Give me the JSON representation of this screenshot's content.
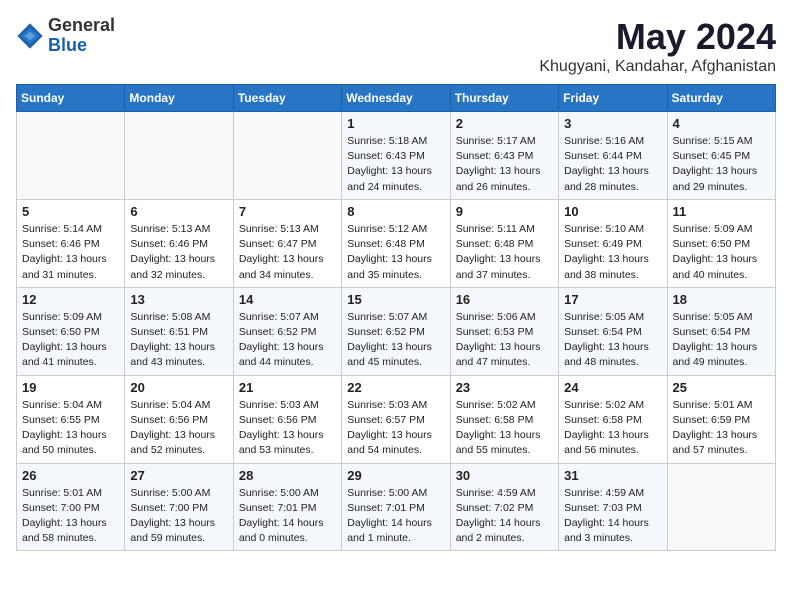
{
  "header": {
    "logo_general": "General",
    "logo_blue": "Blue",
    "month_title": "May 2024",
    "location": "Khugyani, Kandahar, Afghanistan"
  },
  "weekdays": [
    "Sunday",
    "Monday",
    "Tuesday",
    "Wednesday",
    "Thursday",
    "Friday",
    "Saturday"
  ],
  "weeks": [
    [
      {
        "day": "",
        "info": ""
      },
      {
        "day": "",
        "info": ""
      },
      {
        "day": "",
        "info": ""
      },
      {
        "day": "1",
        "info": "Sunrise: 5:18 AM\nSunset: 6:43 PM\nDaylight: 13 hours\nand 24 minutes."
      },
      {
        "day": "2",
        "info": "Sunrise: 5:17 AM\nSunset: 6:43 PM\nDaylight: 13 hours\nand 26 minutes."
      },
      {
        "day": "3",
        "info": "Sunrise: 5:16 AM\nSunset: 6:44 PM\nDaylight: 13 hours\nand 28 minutes."
      },
      {
        "day": "4",
        "info": "Sunrise: 5:15 AM\nSunset: 6:45 PM\nDaylight: 13 hours\nand 29 minutes."
      }
    ],
    [
      {
        "day": "5",
        "info": "Sunrise: 5:14 AM\nSunset: 6:46 PM\nDaylight: 13 hours\nand 31 minutes."
      },
      {
        "day": "6",
        "info": "Sunrise: 5:13 AM\nSunset: 6:46 PM\nDaylight: 13 hours\nand 32 minutes."
      },
      {
        "day": "7",
        "info": "Sunrise: 5:13 AM\nSunset: 6:47 PM\nDaylight: 13 hours\nand 34 minutes."
      },
      {
        "day": "8",
        "info": "Sunrise: 5:12 AM\nSunset: 6:48 PM\nDaylight: 13 hours\nand 35 minutes."
      },
      {
        "day": "9",
        "info": "Sunrise: 5:11 AM\nSunset: 6:48 PM\nDaylight: 13 hours\nand 37 minutes."
      },
      {
        "day": "10",
        "info": "Sunrise: 5:10 AM\nSunset: 6:49 PM\nDaylight: 13 hours\nand 38 minutes."
      },
      {
        "day": "11",
        "info": "Sunrise: 5:09 AM\nSunset: 6:50 PM\nDaylight: 13 hours\nand 40 minutes."
      }
    ],
    [
      {
        "day": "12",
        "info": "Sunrise: 5:09 AM\nSunset: 6:50 PM\nDaylight: 13 hours\nand 41 minutes."
      },
      {
        "day": "13",
        "info": "Sunrise: 5:08 AM\nSunset: 6:51 PM\nDaylight: 13 hours\nand 43 minutes."
      },
      {
        "day": "14",
        "info": "Sunrise: 5:07 AM\nSunset: 6:52 PM\nDaylight: 13 hours\nand 44 minutes."
      },
      {
        "day": "15",
        "info": "Sunrise: 5:07 AM\nSunset: 6:52 PM\nDaylight: 13 hours\nand 45 minutes."
      },
      {
        "day": "16",
        "info": "Sunrise: 5:06 AM\nSunset: 6:53 PM\nDaylight: 13 hours\nand 47 minutes."
      },
      {
        "day": "17",
        "info": "Sunrise: 5:05 AM\nSunset: 6:54 PM\nDaylight: 13 hours\nand 48 minutes."
      },
      {
        "day": "18",
        "info": "Sunrise: 5:05 AM\nSunset: 6:54 PM\nDaylight: 13 hours\nand 49 minutes."
      }
    ],
    [
      {
        "day": "19",
        "info": "Sunrise: 5:04 AM\nSunset: 6:55 PM\nDaylight: 13 hours\nand 50 minutes."
      },
      {
        "day": "20",
        "info": "Sunrise: 5:04 AM\nSunset: 6:56 PM\nDaylight: 13 hours\nand 52 minutes."
      },
      {
        "day": "21",
        "info": "Sunrise: 5:03 AM\nSunset: 6:56 PM\nDaylight: 13 hours\nand 53 minutes."
      },
      {
        "day": "22",
        "info": "Sunrise: 5:03 AM\nSunset: 6:57 PM\nDaylight: 13 hours\nand 54 minutes."
      },
      {
        "day": "23",
        "info": "Sunrise: 5:02 AM\nSunset: 6:58 PM\nDaylight: 13 hours\nand 55 minutes."
      },
      {
        "day": "24",
        "info": "Sunrise: 5:02 AM\nSunset: 6:58 PM\nDaylight: 13 hours\nand 56 minutes."
      },
      {
        "day": "25",
        "info": "Sunrise: 5:01 AM\nSunset: 6:59 PM\nDaylight: 13 hours\nand 57 minutes."
      }
    ],
    [
      {
        "day": "26",
        "info": "Sunrise: 5:01 AM\nSunset: 7:00 PM\nDaylight: 13 hours\nand 58 minutes."
      },
      {
        "day": "27",
        "info": "Sunrise: 5:00 AM\nSunset: 7:00 PM\nDaylight: 13 hours\nand 59 minutes."
      },
      {
        "day": "28",
        "info": "Sunrise: 5:00 AM\nSunset: 7:01 PM\nDaylight: 14 hours\nand 0 minutes."
      },
      {
        "day": "29",
        "info": "Sunrise: 5:00 AM\nSunset: 7:01 PM\nDaylight: 14 hours\nand 1 minute."
      },
      {
        "day": "30",
        "info": "Sunrise: 4:59 AM\nSunset: 7:02 PM\nDaylight: 14 hours\nand 2 minutes."
      },
      {
        "day": "31",
        "info": "Sunrise: 4:59 AM\nSunset: 7:03 PM\nDaylight: 14 hours\nand 3 minutes."
      },
      {
        "day": "",
        "info": ""
      }
    ]
  ]
}
